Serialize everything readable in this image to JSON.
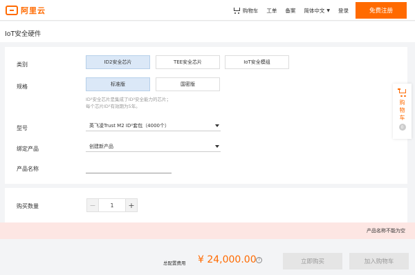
{
  "header": {
    "logo_text": "阿里云",
    "nav": {
      "cart": "购物车",
      "ticket": "工单",
      "record": "备案",
      "language": "简体中文",
      "login": "登录"
    },
    "signup": "免费注册"
  },
  "page_title": "IoT安全硬件",
  "form": {
    "category": {
      "label": "类别",
      "options": [
        {
          "label": "ID2安全芯片",
          "selected": true
        },
        {
          "label": "TEE安全芯片",
          "selected": false
        },
        {
          "label": "IoT安全模组",
          "selected": false
        }
      ]
    },
    "spec": {
      "label": "规格",
      "options": [
        {
          "label": "标准版",
          "selected": true
        },
        {
          "label": "国密版",
          "selected": false
        }
      ],
      "hint_line1": "ID²安全芯片是集成了ID²安全能力的芯片；",
      "hint_line2": "每个芯片ID²有效期为5年。"
    },
    "model": {
      "label": "型号",
      "value": "英飞凌Trust M2 ID²套包（4000个）"
    },
    "bind_product": {
      "label": "绑定产品",
      "value": "创建新产品"
    },
    "product_name": {
      "label": "产品名称",
      "value": ""
    }
  },
  "side_cart": {
    "label": "购物车",
    "count": "0"
  },
  "quantity": {
    "label": "购买数量",
    "value": "1",
    "minus": "−",
    "plus": "+"
  },
  "error": "产品名称不能为空",
  "footer": {
    "price_label": "总配置费用",
    "price": "¥ 24,000.00",
    "help": "?",
    "buy_now": "立即购买",
    "add_cart": "加入购物车"
  },
  "colors": {
    "brand": "#ff6a00",
    "selected_option": "#dbe8f7",
    "error_bg": "#fde6e3"
  }
}
